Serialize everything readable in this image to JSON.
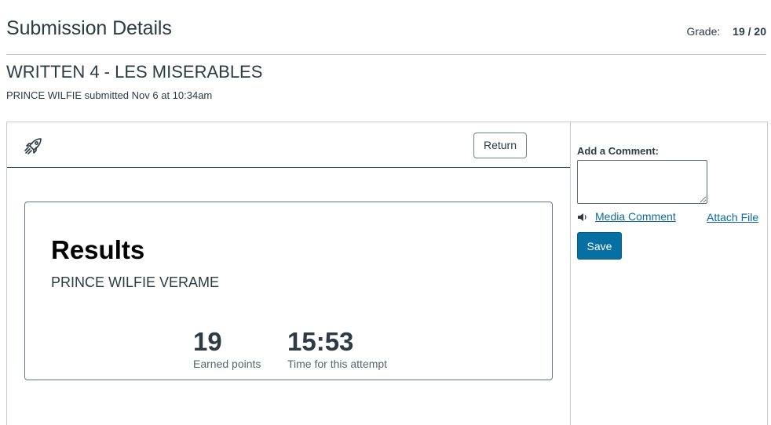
{
  "header": {
    "title": "Submission Details",
    "grade_label": "Grade:",
    "grade_value": "19 / 20"
  },
  "assignment": {
    "title": "WRITTEN 4 - LES MISERABLES",
    "submitted_line": "PRINCE WILFIE submitted Nov 6 at 10:34am"
  },
  "toolbar": {
    "icon": "rocket-icon",
    "return_label": "Return"
  },
  "results": {
    "heading": "Results",
    "student_name": "PRINCE WILFIE VERAME",
    "points_value": "19",
    "points_label": "Earned points",
    "time_value": "15:53",
    "time_label": "Time for this attempt"
  },
  "comment": {
    "label": "Add a Comment:",
    "value": "",
    "media_icon": "speaker-icon",
    "media_label": "Media Comment",
    "attach_label": "Attach File",
    "save_label": "Save"
  },
  "colors": {
    "link": "#0b6a9e",
    "save_button": "#0770a3",
    "text": "#2d3b45"
  }
}
